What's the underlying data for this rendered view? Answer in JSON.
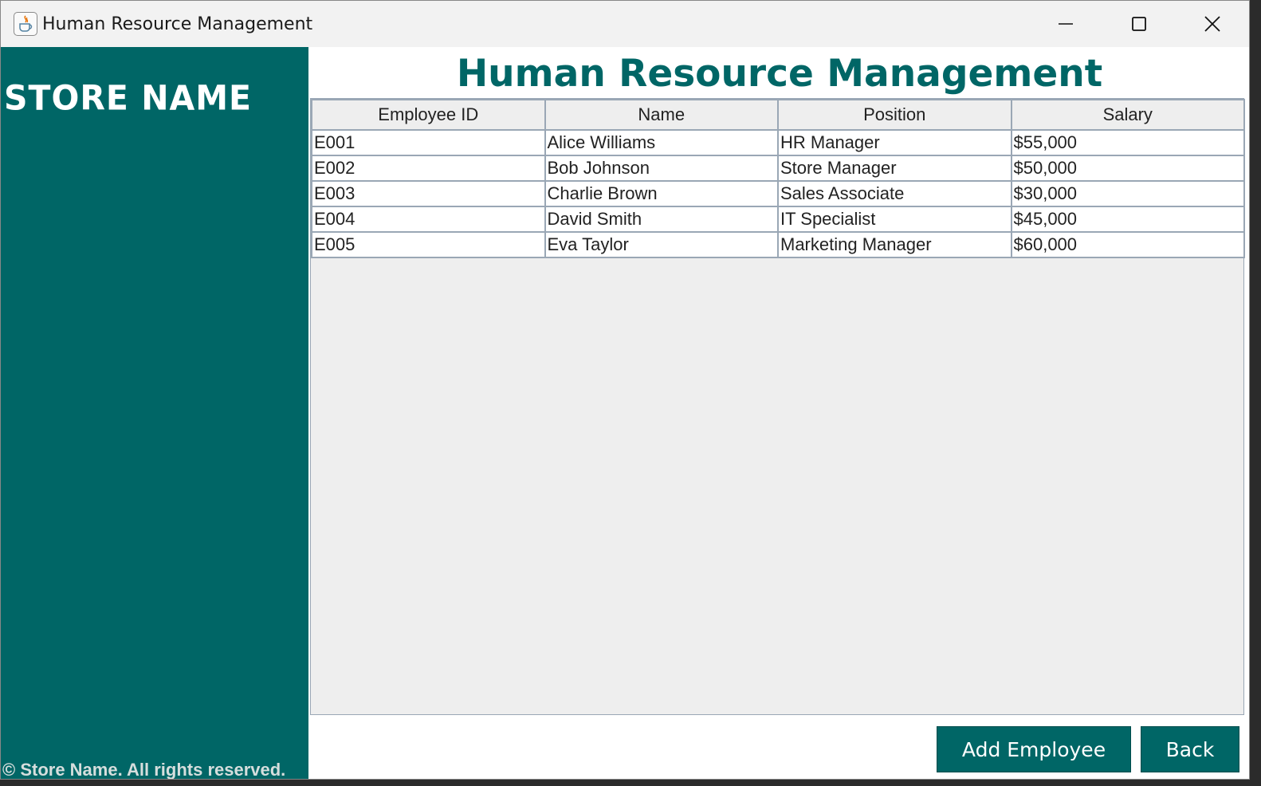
{
  "window": {
    "title": "Human Resource Management",
    "icon": "java-icon"
  },
  "sidebar": {
    "store_name": "Store Name",
    "copyright": "© Store Name. All rights reserved."
  },
  "main": {
    "title": "Human Resource Management",
    "table": {
      "columns": [
        "Employee ID",
        "Name",
        "Position",
        "Salary"
      ],
      "rows": [
        [
          "E001",
          "Alice Williams",
          "HR Manager",
          "$55,000"
        ],
        [
          "E002",
          "Bob Johnson",
          "Store Manager",
          "$50,000"
        ],
        [
          "E003",
          "Charlie Brown",
          "Sales Associate",
          "$30,000"
        ],
        [
          "E004",
          "David Smith",
          "IT Specialist",
          "$45,000"
        ],
        [
          "E005",
          "Eva Taylor",
          "Marketing Manager",
          "$60,000"
        ]
      ]
    },
    "buttons": {
      "add_employee": "Add Employee",
      "back": "Back"
    }
  },
  "colors": {
    "accent": "#006666",
    "table_border": "#9aa7b5",
    "table_bg": "#eeeeee"
  }
}
